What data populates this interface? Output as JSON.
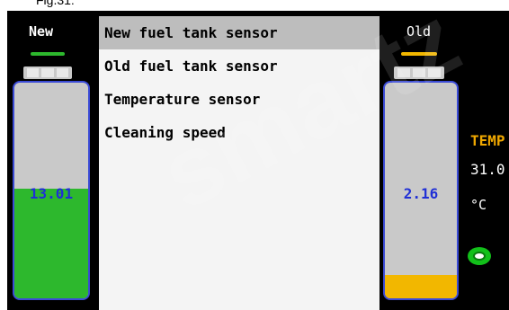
{
  "caption": "Fig.31:",
  "left_tank": {
    "title": "New",
    "value": "13.01",
    "fill_fraction": 0.51,
    "fill_color": "#2db82d",
    "indicator_color": "#2db82d"
  },
  "menu": {
    "items": [
      {
        "label": "New fuel tank sensor",
        "selected": true
      },
      {
        "label": "Old fuel tank sensor",
        "selected": false
      },
      {
        "label": "Temperature sensor",
        "selected": false
      },
      {
        "label": "Cleaning speed",
        "selected": false
      }
    ]
  },
  "right_tank": {
    "title": "Old",
    "value": "2.16",
    "fill_fraction": 0.11,
    "fill_color": "#f2b700",
    "indicator_color": "#f2b700"
  },
  "temperature": {
    "label": "TEMP",
    "value": "31.0",
    "unit": "°C"
  },
  "watermark": "smartz",
  "icons": {
    "status": "gear-icon"
  }
}
